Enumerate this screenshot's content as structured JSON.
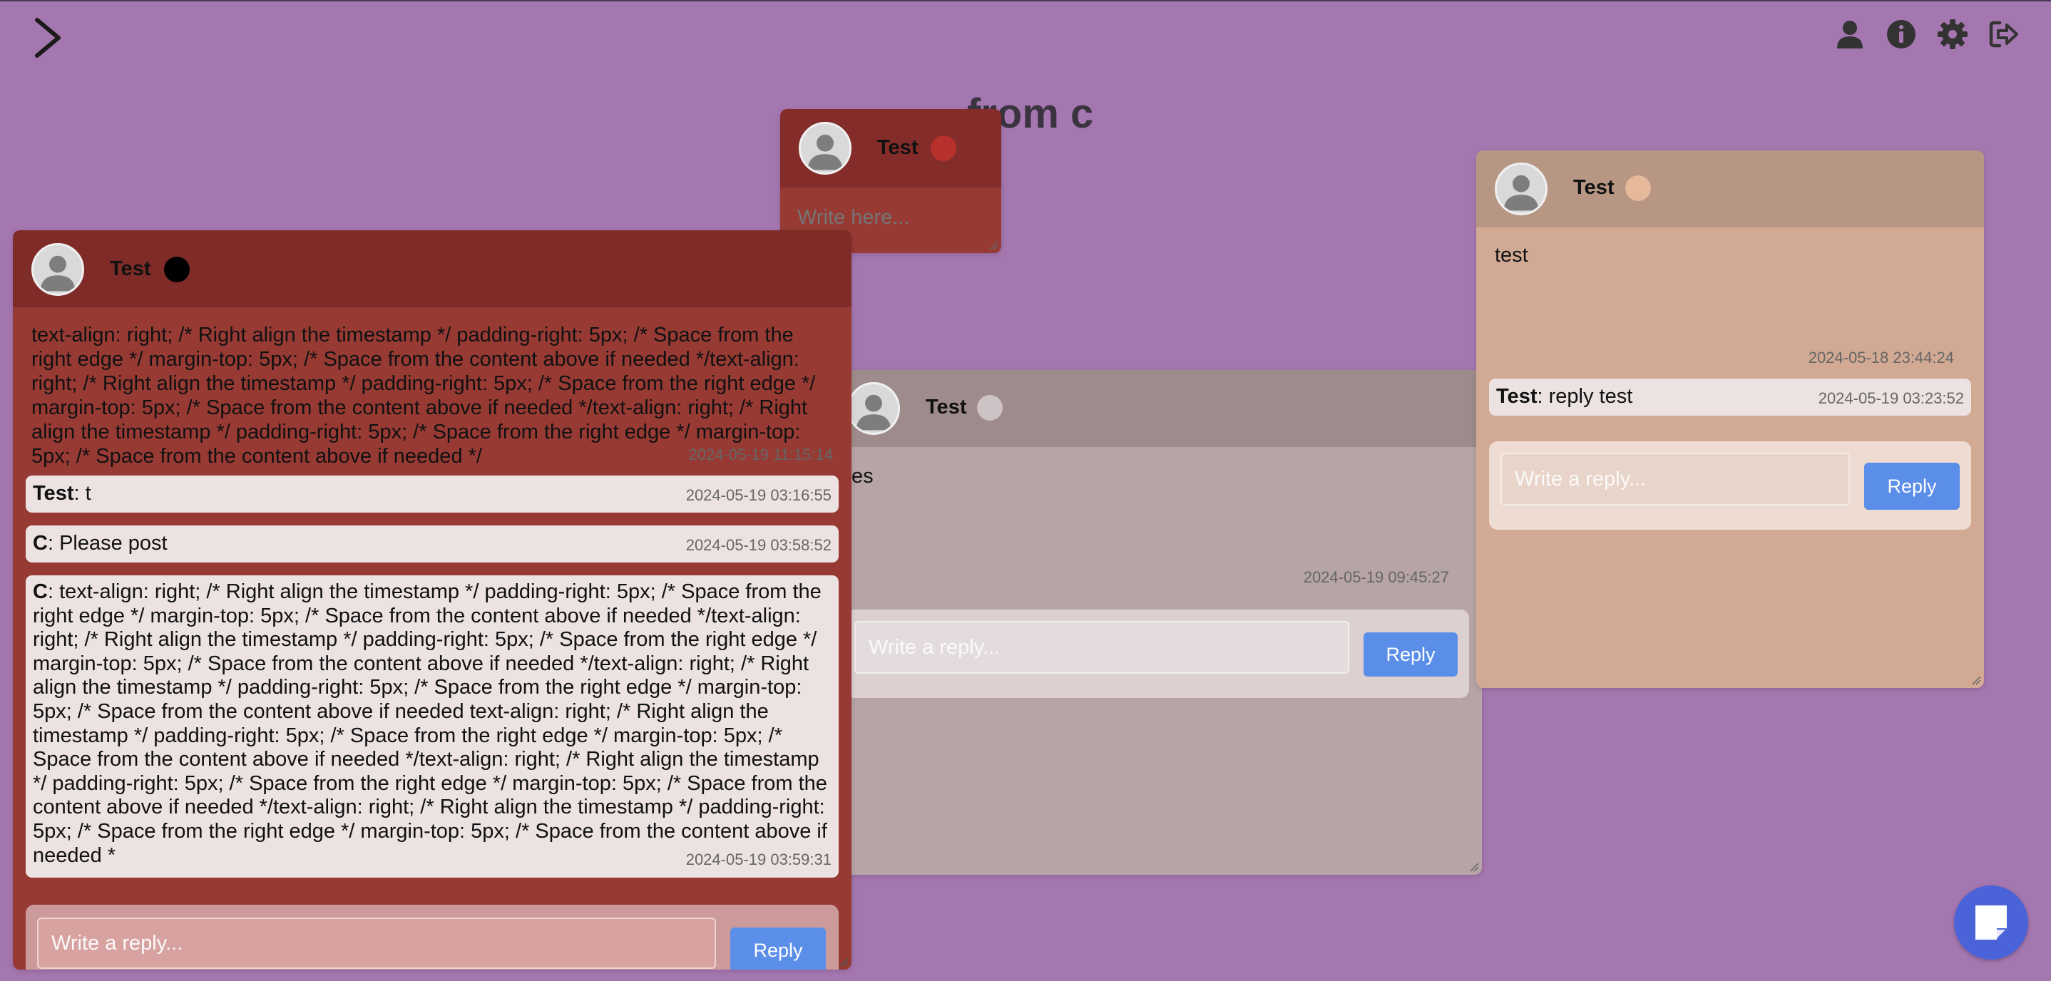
{
  "board": {
    "title": "from c"
  },
  "top_icons": [
    "user-icon",
    "info-icon",
    "gear-icon",
    "logout-icon"
  ],
  "colors": {
    "background": "#a577b0",
    "note_red": "#973a34",
    "note_gray": "#b6a4a6",
    "note_peach": "#d2aa94",
    "button_blue": "#5b8ee8"
  },
  "notes": {
    "small": {
      "author": "Test",
      "status_color": "#b8302c",
      "placeholder": "Write here..."
    },
    "red": {
      "author": "Test",
      "status_color": "#000000",
      "content": "text-align: right; /* Right align the timestamp */ padding-right: 5px; /* Space from the right edge */ margin-top: 5px; /* Space from the content above if needed */text-align: right; /* Right align the timestamp */ padding-right: 5px; /* Space from the right edge */ margin-top: 5px; /* Space from the content above if needed */text-align: right; /* Right align the timestamp */ padding-right: 5px; /* Space from the right edge */ margin-top: 5px; /* Space from the content above if needed */",
      "timestamp": "2024-05-19 11:15:14",
      "replies": [
        {
          "author": "Test",
          "text": ": t",
          "timestamp": "2024-05-19 03:16:55"
        },
        {
          "author": "C",
          "text": ": Please post",
          "timestamp": "2024-05-19 03:58:52"
        },
        {
          "author": "C",
          "text": ": text-align: right; /* Right align the timestamp */ padding-right: 5px; /* Space from the right edge */ margin-top: 5px; /* Space from the content above if needed */text-align: right; /* Right align the timestamp */ padding-right: 5px; /* Space from the right edge */ margin-top: 5px; /* Space from the content above if needed */text-align: right; /* Right align the timestamp */ padding-right: 5px; /* Space from the right edge */ margin-top: 5px; /* Space from the content above if needed text-align: right; /* Right align the timestamp */ padding-right: 5px; /* Space from the right edge */ margin-top: 5px; /* Space from the content above if needed */text-align: right; /* Right align the timestamp */ padding-right: 5px; /* Space from the right edge */ margin-top: 5px; /* Space from the content above if needed */text-align: right; /* Right align the timestamp */ padding-right: 5px; /* Space from the right edge */ margin-top: 5px; /* Space from the content above if needed *",
          "timestamp": "2024-05-19 03:59:31"
        }
      ],
      "reply_placeholder": "Write a reply...",
      "reply_button": "Reply"
    },
    "gray": {
      "author": "Test",
      "status_color": "#cdc3c4",
      "content": "es",
      "timestamp": "2024-05-19 09:45:27",
      "reply_placeholder": "Write a reply...",
      "reply_button": "Reply"
    },
    "peach": {
      "author": "Test",
      "status_color": "#e6b99a",
      "content": "test",
      "timestamp": "2024-05-18 23:44:24",
      "replies": [
        {
          "author": "Test",
          "text": ": reply test",
          "timestamp": "2024-05-19 03:23:52"
        }
      ],
      "reply_placeholder": "Write a reply...",
      "reply_button": "Reply"
    }
  },
  "fab": {
    "icon": "new-note-icon"
  }
}
